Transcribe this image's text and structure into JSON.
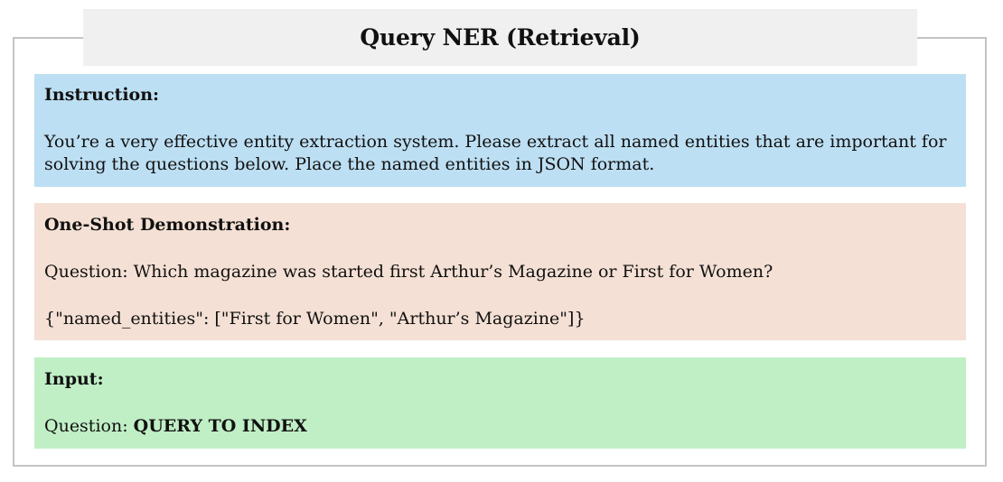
{
  "title": "Query NER (Retrieval)",
  "instruction": {
    "heading": "Instruction:",
    "text": "You’re a very effective entity extraction system. Please extract all named entities that are important for solving the questions below. Place the named entities in JSON format."
  },
  "demonstration": {
    "heading": "One-Shot Demonstration:",
    "question": "Question: Which magazine was started first Arthur’s Magazine or First for Women?",
    "answer": "{\"named_entities\": [\"First for Women\", \"Arthur’s Magazine\"]}"
  },
  "input": {
    "heading": "Input:",
    "question_prefix": "Question: ",
    "question_value": "QUERY TO INDEX"
  },
  "colors": {
    "instruction_bg": "#bddff3",
    "demonstration_bg": "#f4e0d4",
    "input_bg": "#c0efc5",
    "title_bg": "#f0f0f0",
    "frame_border": "#c4c4c4"
  }
}
